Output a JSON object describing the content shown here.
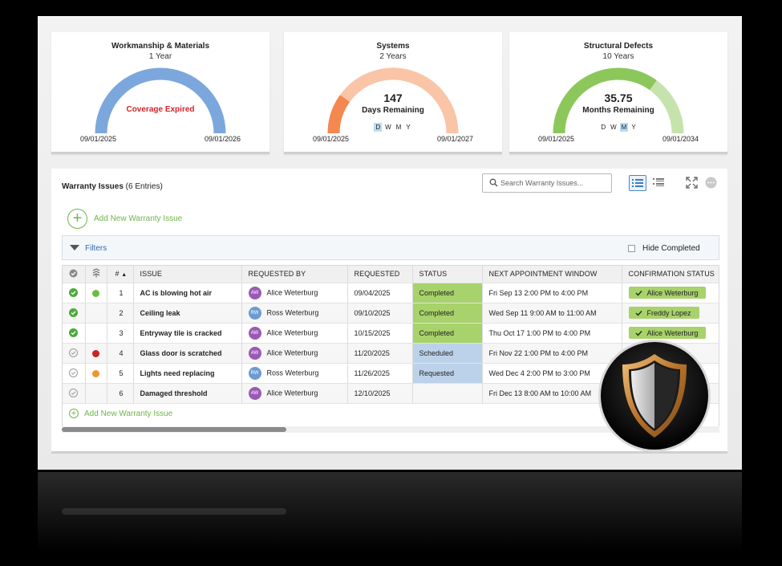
{
  "gauges": [
    {
      "title": "Workmanship & Materials",
      "duration": "1 Year",
      "status_text": "Coverage Expired",
      "start_date": "09/01/2025",
      "end_date": "09/01/2026",
      "color": "#7ba7dc",
      "remaining_fraction": 0
    },
    {
      "title": "Systems",
      "duration": "2 Years",
      "value": "147",
      "value_label": "Days Remaining",
      "units": [
        "D",
        "W",
        "M",
        "Y"
      ],
      "selected_unit": "D",
      "start_date": "09/01/2025",
      "end_date": "09/01/2027",
      "color": "#f4884f",
      "remaining_fraction": 0.8
    },
    {
      "title": "Structural Defects",
      "duration": "10 Years",
      "value": "35.75",
      "value_label": "Months Remaining",
      "units": [
        "D",
        "W",
        "M",
        "Y"
      ],
      "selected_unit": "M",
      "start_date": "09/01/2025",
      "end_date": "09/01/2034",
      "color": "#8cc75b",
      "remaining_fraction": 0.3
    }
  ],
  "issues_panel": {
    "title": "Warranty Issues",
    "entries_text": "(6 Entries)",
    "search_placeholder": "Search Warranty Issues...",
    "add_new_label": "Add New Warranty Issue",
    "filters_label": "Filters",
    "hide_completed_label": "Hide Completed",
    "add_new_bottom_label": "Add New Warranty Issue"
  },
  "table": {
    "columns": [
      "#",
      "ISSUE",
      "REQUESTED BY",
      "REQUESTED",
      "STATUS",
      "NEXT APPOINTMENT WINDOW",
      "CONFIRMATION STATUS"
    ],
    "rows": [
      {
        "done": true,
        "priority": "green",
        "num": "1",
        "issue": "AC is blowing hot air",
        "initials": "AW",
        "requester": "Alice Weterburg",
        "requested": "09/04/2025",
        "status": "Completed",
        "appointment": "Fri Sep 13 2:00 PM to 4:00 PM",
        "confirmation": "Alice Weterburg"
      },
      {
        "done": true,
        "priority": "",
        "num": "2",
        "issue": "Ceiling leak",
        "initials": "RW",
        "requester": "Ross Weterburg",
        "requested": "09/10/2025",
        "status": "Completed",
        "appointment": "Wed Sep 11 9:00 AM to 11:00 AM",
        "confirmation": "Freddy Lopez"
      },
      {
        "done": true,
        "priority": "",
        "num": "3",
        "issue": "Entryway tile is cracked",
        "initials": "AW",
        "requester": "Alice Weterburg",
        "requested": "10/15/2025",
        "status": "Completed",
        "appointment": "Thu Oct 17 1:00 PM to 4:00 PM",
        "confirmation": "Alice Weterburg"
      },
      {
        "done": false,
        "priority": "red",
        "num": "4",
        "issue": "Glass door is scratched",
        "initials": "AW",
        "requester": "Alice Weterburg",
        "requested": "11/20/2025",
        "status": "Scheduled",
        "appointment": "Fri Nov 22 1:00 PM to 4:00 PM",
        "confirmation": ""
      },
      {
        "done": false,
        "priority": "orange",
        "num": "5",
        "issue": "Lights need replacing",
        "initials": "RW",
        "requester": "Ross Weterburg",
        "requested": "11/26/2025",
        "status": "Requested",
        "appointment": "Wed Dec 4 2:00 PM to 3:00 PM",
        "confirmation": ""
      },
      {
        "done": false,
        "priority": "",
        "num": "6",
        "issue": "Damaged threshold",
        "initials": "AW",
        "requester": "Alice Weterburg",
        "requested": "12/10/2025",
        "status": "",
        "appointment": "Fri Dec 13 8:00 AM to 10:00 AM",
        "confirmation": ""
      }
    ],
    "avatar_colors": {
      "AW": "#9b59b6",
      "RW": "#6b9bd1"
    },
    "priority_colors": {
      "green": "#6dbb3f",
      "red": "#c92323",
      "orange": "#f0952c"
    }
  },
  "colors": {
    "accent_green": "#6fb54a",
    "link_blue": "#2d6fae",
    "status_completed": "#a8d26b",
    "status_pending": "#bcd2ea"
  },
  "icons": [
    "search-icon",
    "list-view-icon",
    "detail-view-icon",
    "expand-icon",
    "more-icon",
    "plus-icon",
    "check-icon",
    "shield-icon"
  ]
}
